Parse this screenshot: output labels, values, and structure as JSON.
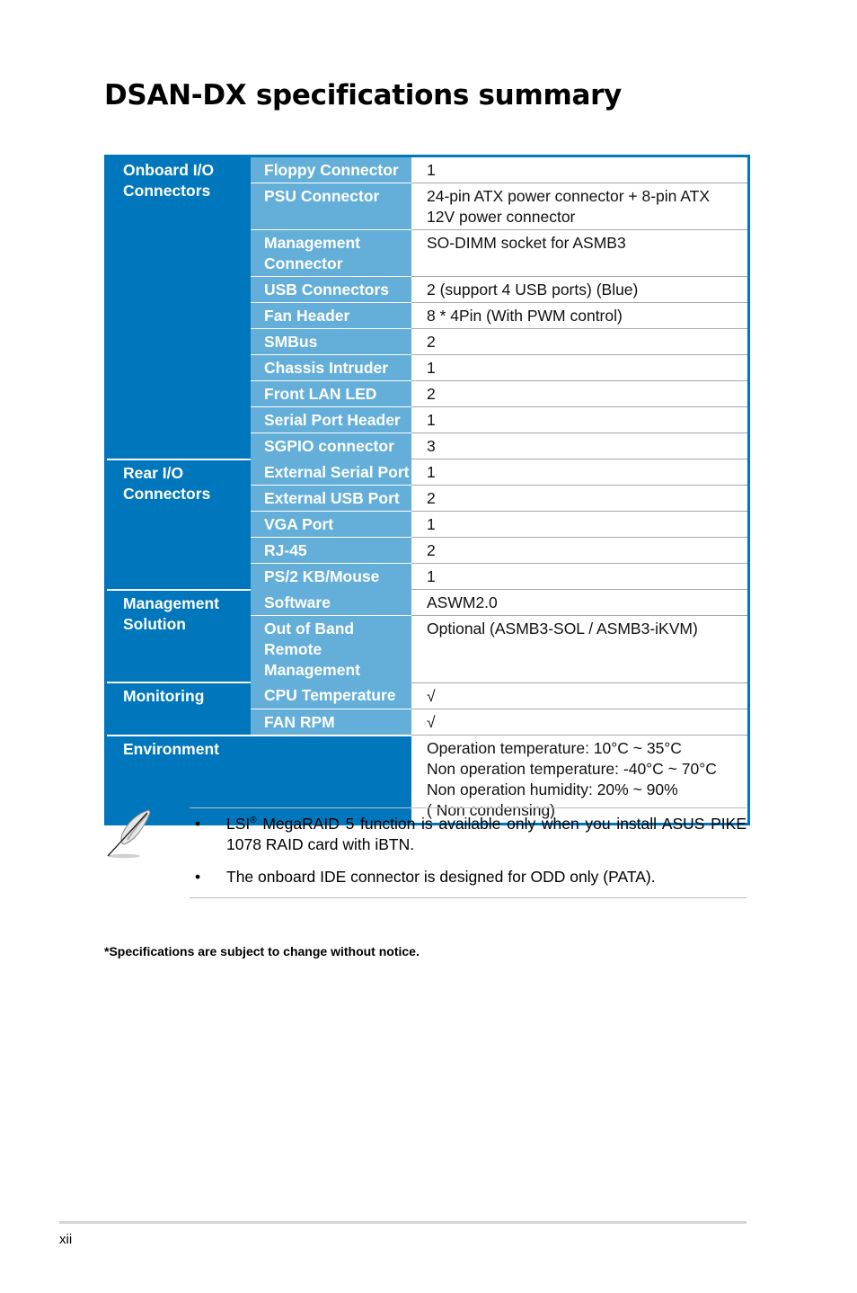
{
  "page": {
    "title": "DSAN-DX specifications summary",
    "page_number": "xii"
  },
  "colors": {
    "category_bg": "#0077bd",
    "subcategory_bg": "#64afd9",
    "value_bg": "#ffffff"
  },
  "spec_groups": [
    {
      "category": "Onboard I/O Connectors",
      "rows": [
        {
          "label": "Floppy Connector",
          "value": [
            "1"
          ]
        },
        {
          "label": "PSU Connector",
          "value": [
            "24-pin ATX power connector + 8-pin ATX",
            "12V power connector"
          ]
        },
        {
          "label": "Management Connector",
          "value": [
            "SO-DIMM socket for ASMB3"
          ]
        },
        {
          "label": "USB Connectors",
          "value": [
            "2 (support 4 USB ports) (Blue)"
          ]
        },
        {
          "label": "Fan Header",
          "value": [
            "8 * 4Pin (With PWM control)"
          ]
        },
        {
          "label": "SMBus",
          "value": [
            "2"
          ]
        },
        {
          "label": "Chassis Intruder",
          "value": [
            "1"
          ]
        },
        {
          "label": "Front LAN LED",
          "value": [
            "2"
          ]
        },
        {
          "label": "Serial Port Header",
          "value": [
            "1"
          ]
        },
        {
          "label": "SGPIO connector",
          "value": [
            "3"
          ]
        }
      ]
    },
    {
      "category": "Rear I/O Connectors",
      "rows": [
        {
          "label": "External Serial Port",
          "value": [
            "1"
          ]
        },
        {
          "label": "External USB Port",
          "value": [
            "2"
          ]
        },
        {
          "label": "VGA Port",
          "value": [
            "1"
          ]
        },
        {
          "label": "RJ-45",
          "value": [
            "2"
          ]
        },
        {
          "label": "PS/2  KB/Mouse",
          "value": [
            "1"
          ]
        }
      ]
    },
    {
      "category": "Management Solution",
      "rows": [
        {
          "label": "Software",
          "value": [
            "ASWM2.0"
          ]
        },
        {
          "label": "Out of Band Remote Management",
          "value": [
            "Optional (ASMB3-SOL / ASMB3-iKVM)"
          ]
        }
      ]
    },
    {
      "category": "Monitoring",
      "rows": [
        {
          "label": "CPU Temperature",
          "value": [
            "√"
          ]
        },
        {
          "label": "FAN RPM",
          "value": [
            "√"
          ]
        }
      ]
    }
  ],
  "environment": {
    "category": "Environment",
    "value": [
      "Operation temperature: 10°C ~ 35°C",
      "Non operation temperature: -40°C ~ 70°C",
      "Non operation humidity: 20% ~ 90%",
      "( Non condensing)"
    ]
  },
  "note": {
    "icon": "feather-pen-icon",
    "bullet": "•",
    "items": [
      {
        "prefix": "LSI",
        "superscript": "®",
        "text": " MegaRAID 5 function is available only when you install ASUS PIKE 1078 RAID card with iBTN."
      },
      {
        "prefix": "",
        "superscript": "",
        "text": "The onboard IDE connector is designed for ODD only (PATA)."
      }
    ]
  },
  "disclaimer": "*Specifications are subject to change without notice."
}
